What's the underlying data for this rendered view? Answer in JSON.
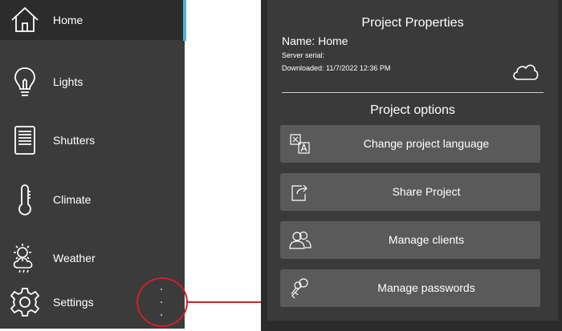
{
  "sidebar": {
    "items": [
      {
        "label": "Home",
        "icon": "home-icon"
      },
      {
        "label": "Lights",
        "icon": "lightbulb-icon"
      },
      {
        "label": "Shutters",
        "icon": "shutters-icon"
      },
      {
        "label": "Climate",
        "icon": "thermometer-icon"
      },
      {
        "label": "Weather",
        "icon": "weather-icon"
      },
      {
        "label": "Settings",
        "icon": "gear-icon"
      }
    ],
    "more_icon": "more-vertical-icon",
    "accent_color": "#4fb3d6",
    "highlight_color": "#d0202a"
  },
  "panel": {
    "project_properties_title": "Project Properties",
    "name_line": "Name: Home",
    "server_serial_line": "Server serial:",
    "downloaded_line": "Downloaded: 11/7/2022 12:36 PM",
    "cloud_icon": "cloud-icon",
    "project_options_title": "Project options",
    "options": [
      {
        "label": "Change project language",
        "icon": "translate-icon"
      },
      {
        "label": "Share Project",
        "icon": "share-icon"
      },
      {
        "label": "Manage clients",
        "icon": "users-icon"
      },
      {
        "label": "Manage passwords",
        "icon": "keys-icon"
      }
    ]
  }
}
